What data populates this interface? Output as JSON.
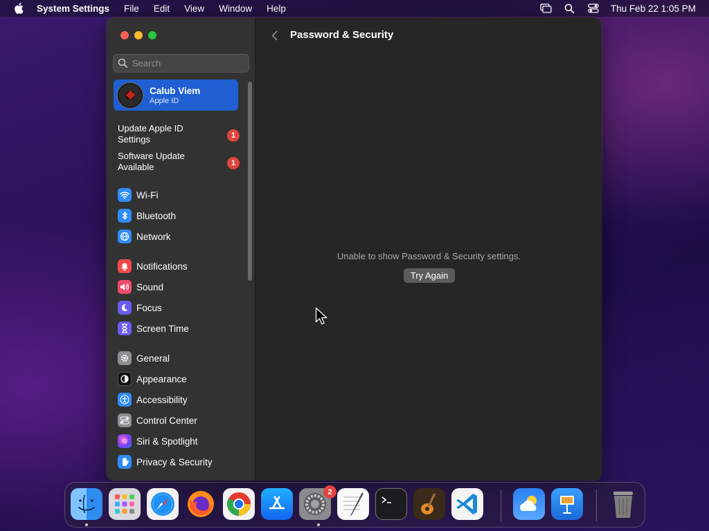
{
  "menubar": {
    "app_name": "System Settings",
    "menus": [
      "File",
      "Edit",
      "View",
      "Window",
      "Help"
    ],
    "clock": "Thu Feb 22  1:05 PM",
    "icons": [
      "screen-mirroring-icon",
      "spotlight-search-icon",
      "control-center-icon"
    ]
  },
  "sidebar": {
    "search_placeholder": "Search",
    "account": {
      "name": "Calub Viem",
      "subtitle": "Apple ID"
    },
    "notices": [
      {
        "label": "Update Apple ID Settings",
        "badge": "1"
      },
      {
        "label": "Software Update Available",
        "badge": "1"
      }
    ],
    "groups": [
      [
        {
          "label": "Wi-Fi",
          "icon": "wifi-icon",
          "color": "#2f8cf7"
        },
        {
          "label": "Bluetooth",
          "icon": "bluetooth-icon",
          "color": "#2f8cf7"
        },
        {
          "label": "Network",
          "icon": "network-icon",
          "color": "#2f8cf7"
        }
      ],
      [
        {
          "label": "Notifications",
          "icon": "notifications-icon",
          "color": "#f04a4a"
        },
        {
          "label": "Sound",
          "icon": "sound-icon",
          "color": "#f04a6a"
        },
        {
          "label": "Focus",
          "icon": "focus-icon",
          "color": "#6a5cf0"
        },
        {
          "label": "Screen Time",
          "icon": "screen-time-icon",
          "color": "#6a5cf0"
        }
      ],
      [
        {
          "label": "General",
          "icon": "general-icon",
          "color": "#8e8e93"
        },
        {
          "label": "Appearance",
          "icon": "appearance-icon",
          "color": "#111111"
        },
        {
          "label": "Accessibility",
          "icon": "accessibility-icon",
          "color": "#2f8cf7"
        },
        {
          "label": "Control Center",
          "icon": "control-center-icon",
          "color": "#8e8e93"
        },
        {
          "label": "Siri & Spotlight",
          "icon": "siri-icon",
          "color": "#b04ad0"
        },
        {
          "label": "Privacy & Security",
          "icon": "privacy-hand-icon",
          "color": "#2f8cf7"
        }
      ]
    ]
  },
  "main": {
    "title": "Password & Security",
    "message": "Unable to show Password & Security settings.",
    "try_again_label": "Try Again"
  },
  "dock": {
    "apps": [
      {
        "name": "Finder",
        "icon": "finder-icon",
        "running": true
      },
      {
        "name": "Launchpad",
        "icon": "launchpad-icon",
        "running": false
      },
      {
        "name": "Safari",
        "icon": "safari-icon",
        "running": false
      },
      {
        "name": "Firefox",
        "icon": "firefox-icon",
        "running": false
      },
      {
        "name": "Chrome",
        "icon": "chrome-icon",
        "running": false
      },
      {
        "name": "App Store",
        "icon": "app-store-icon",
        "running": false
      },
      {
        "name": "System Settings",
        "icon": "system-settings-icon",
        "running": true,
        "badge": "2"
      },
      {
        "name": "TextEdit",
        "icon": "textedit-icon",
        "running": false
      },
      {
        "name": "Terminal",
        "icon": "terminal-icon",
        "running": false
      },
      {
        "name": "GarageBand",
        "icon": "garageband-icon",
        "running": false
      },
      {
        "name": "Visual Studio Code",
        "icon": "vscode-icon",
        "running": false
      },
      {
        "name": "Weather",
        "icon": "weather-icon",
        "running": false
      },
      {
        "name": "Keynote",
        "icon": "keynote-icon",
        "running": false
      },
      {
        "name": "Trash",
        "icon": "trash-icon",
        "running": false
      }
    ]
  }
}
